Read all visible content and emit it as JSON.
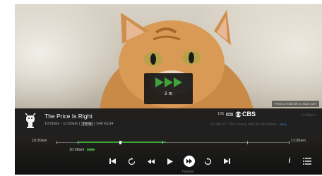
{
  "skip": {
    "label": "3 m"
  },
  "hint": "Press & hold OK to start over",
  "program": {
    "title": "The Price Is Right",
    "time_range": "10:00am - 11:00am",
    "rating": "TV-G",
    "episode": "S48 E134"
  },
  "channel": {
    "number": "105",
    "hd": "HD",
    "network": "CBS"
  },
  "clock": "10:44am",
  "up_next": {
    "label": "UP NEXT: The Young and the Restless",
    "badge": "NEW"
  },
  "timeline": {
    "start": "10:30am",
    "end": "11:30am",
    "current": "10:38am",
    "position_fraction": 0.27,
    "live_fraction": 0.47
  },
  "controls": {
    "active_label": "Forward",
    "items": [
      "skip-back-icon",
      "replay-icon",
      "rewind-icon",
      "play-icon",
      "fast-forward-icon",
      "advance-icon",
      "skip-forward-icon"
    ]
  },
  "colors": {
    "accent_green": "#3fa33a",
    "bar_bg": "#1a1a1a",
    "new_badge": "#4a8fd6"
  }
}
